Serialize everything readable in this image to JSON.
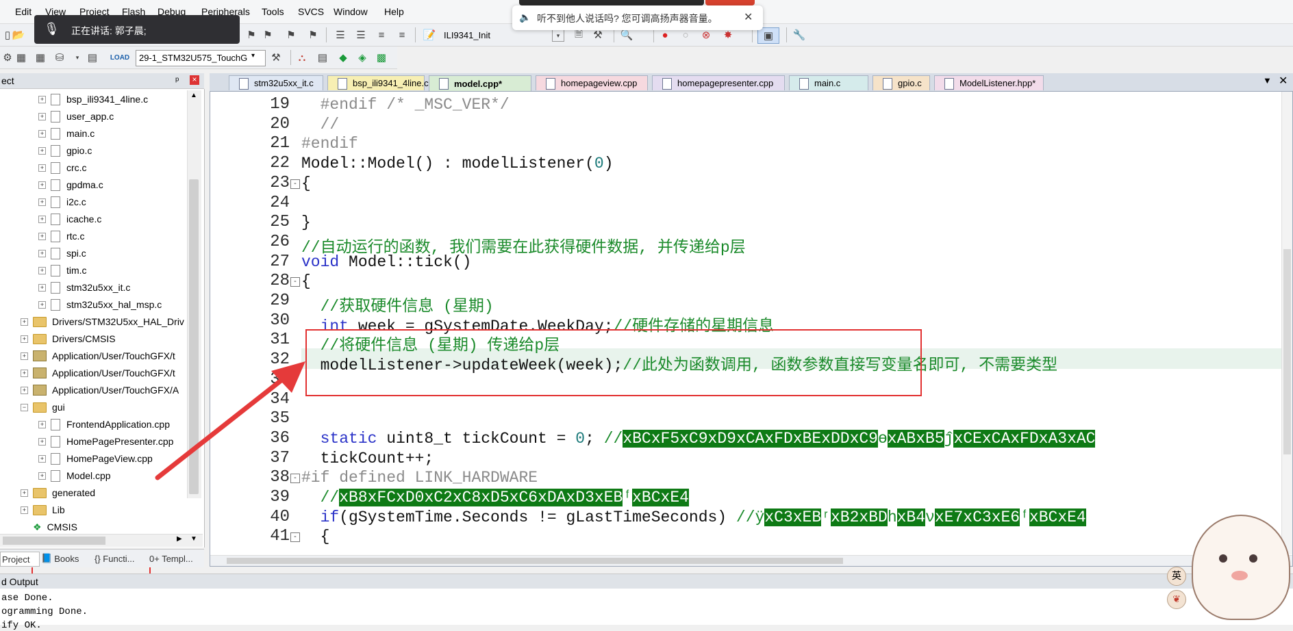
{
  "menu": [
    "Edit",
    "View",
    "Project",
    "Flash",
    "Debug",
    "Peripherals",
    "Tools",
    "SVCS",
    "Window",
    "Help"
  ],
  "toolbar": {
    "target_func": "ILI9341_Init",
    "target_name": "29-1_STM32U575_TouchG"
  },
  "mic_overlay": {
    "text": "正在讲话: 郭子晨;"
  },
  "notice": {
    "text": "听不到他人说话吗? 您可调高扬声器音量。",
    "close": "✕"
  },
  "project_panel": {
    "title": "ect",
    "pin": "ᵖ",
    "close": "×",
    "tree": [
      {
        "label": "bsp_ili9341_4line.c",
        "kind": "file",
        "indent": 1
      },
      {
        "label": "user_app.c",
        "kind": "file",
        "indent": 1
      },
      {
        "label": "main.c",
        "kind": "file",
        "indent": 1
      },
      {
        "label": "gpio.c",
        "kind": "file",
        "indent": 1
      },
      {
        "label": "crc.c",
        "kind": "file",
        "indent": 1
      },
      {
        "label": "gpdma.c",
        "kind": "file",
        "indent": 1
      },
      {
        "label": "i2c.c",
        "kind": "file",
        "indent": 1
      },
      {
        "label": "icache.c",
        "kind": "file",
        "indent": 1
      },
      {
        "label": "rtc.c",
        "kind": "file",
        "indent": 1
      },
      {
        "label": "spi.c",
        "kind": "file",
        "indent": 1
      },
      {
        "label": "tim.c",
        "kind": "file",
        "indent": 1
      },
      {
        "label": "stm32u5xx_it.c",
        "kind": "file",
        "indent": 1
      },
      {
        "label": "stm32u5xx_hal_msp.c",
        "kind": "file",
        "indent": 1
      },
      {
        "label": "Drivers/STM32U5xx_HAL_Driv",
        "kind": "folder",
        "indent": 0
      },
      {
        "label": "Drivers/CMSIS",
        "kind": "folder",
        "indent": 0
      },
      {
        "label": "Application/User/TouchGFX/t",
        "kind": "app",
        "indent": 0
      },
      {
        "label": "Application/User/TouchGFX/t",
        "kind": "app",
        "indent": 0
      },
      {
        "label": "Application/User/TouchGFX/A",
        "kind": "app",
        "indent": 0
      },
      {
        "label": "gui",
        "kind": "folder-open",
        "indent": 0
      },
      {
        "label": "FrontendApplication.cpp",
        "kind": "file",
        "indent": 1
      },
      {
        "label": "HomePagePresenter.cpp",
        "kind": "file",
        "indent": 1
      },
      {
        "label": "HomePageView.cpp",
        "kind": "file",
        "indent": 1
      },
      {
        "label": "Model.cpp",
        "kind": "file",
        "indent": 1
      },
      {
        "label": "generated",
        "kind": "folder",
        "indent": 0
      },
      {
        "label": "Lib",
        "kind": "folder",
        "indent": 0
      },
      {
        "label": "CMSIS",
        "kind": "gem",
        "indent": 0
      }
    ],
    "tabs": [
      "Project",
      "Books",
      "{} Functi...",
      "0+ Templ..."
    ]
  },
  "editor_tabs": [
    {
      "label": "stm32u5xx_it.c",
      "color": "#dfe7f3"
    },
    {
      "label": "bsp_ili9341_4line.c",
      "color": "#f7efb3"
    },
    {
      "label": "model.cpp*",
      "color": "#d8ecd4",
      "active": true
    },
    {
      "label": "homepageview.cpp",
      "color": "#f6d9df"
    },
    {
      "label": "homepagepresenter.cpp",
      "color": "#e4dcf0"
    },
    {
      "label": "main.c",
      "color": "#d5ebeb"
    },
    {
      "label": "gpio.c",
      "color": "#f6e3c9"
    },
    {
      "label": "ModelListener.hpp*",
      "color": "#f2dcea"
    }
  ],
  "code_lines": [
    {
      "n": "19",
      "parts": [
        [
          "pp",
          "  #endif /* _MSC_VER*/"
        ]
      ]
    },
    {
      "n": "20",
      "parts": [
        [
          "pp",
          "  //"
        ]
      ]
    },
    {
      "n": "21",
      "parts": [
        [
          "pp",
          "#endif"
        ]
      ]
    },
    {
      "n": "22",
      "parts": [
        [
          "id",
          "Model::Model() : modelListener("
        ],
        [
          "num",
          "0"
        ],
        [
          "id",
          ")"
        ]
      ]
    },
    {
      "n": "23",
      "parts": [
        [
          "id",
          "{"
        ]
      ],
      "fold": "-"
    },
    {
      "n": "24",
      "parts": [
        [
          "id",
          ""
        ]
      ]
    },
    {
      "n": "25",
      "parts": [
        [
          "id",
          "}"
        ]
      ]
    },
    {
      "n": "26",
      "parts": [
        [
          "cm",
          "//自动运行的函数, 我们需要在此获得硬件数据, 并传递给p层"
        ]
      ]
    },
    {
      "n": "27",
      "parts": [
        [
          "kw",
          "void"
        ],
        [
          "id",
          " Model::tick()"
        ]
      ]
    },
    {
      "n": "28",
      "parts": [
        [
          "id",
          "{"
        ]
      ],
      "fold": "-"
    },
    {
      "n": "29",
      "parts": [
        [
          "cm",
          "  //获取硬件信息 (星期)"
        ]
      ]
    },
    {
      "n": "30",
      "parts": [
        [
          "kw",
          "  int"
        ],
        [
          "id",
          " week = gSystemDate.WeekDay;"
        ],
        [
          "cm",
          "//硬件存储的星期信息"
        ]
      ]
    },
    {
      "n": "31",
      "parts": [
        [
          "cm",
          "  //将硬件信息 (星期) 传递给p层"
        ]
      ]
    },
    {
      "n": "32",
      "parts": [
        [
          "id",
          "  modelListener->updateWeek(week);"
        ],
        [
          "cm",
          "//此处为函数调用, 函数参数直接写变量名即可, 不需要类型"
        ]
      ]
    },
    {
      "n": "33",
      "parts": [
        [
          "id",
          ""
        ]
      ]
    },
    {
      "n": "34",
      "parts": [
        [
          "id",
          ""
        ]
      ]
    },
    {
      "n": "35",
      "parts": [
        [
          "id",
          ""
        ]
      ]
    },
    {
      "n": "36",
      "parts": [
        [
          "kw",
          "  static"
        ],
        [
          "id",
          " uint8_t tickCount = "
        ],
        [
          "num",
          "0"
        ],
        [
          "id",
          "; "
        ],
        [
          "cm",
          "//"
        ],
        [
          "hl",
          "xBCxF5xC9xD9xCAxFDxBExDDxC9"
        ],
        [
          "cm",
          "ɵ"
        ],
        [
          "hl",
          "xABxB5"
        ],
        [
          "cm",
          "ĵ"
        ],
        [
          "hl",
          "xCExCAxFDxA3xAC"
        ]
      ]
    },
    {
      "n": "37",
      "parts": [
        [
          "id",
          "  tickCount++;"
        ]
      ]
    },
    {
      "n": "38",
      "parts": [
        [
          "pp",
          "#if defined LINK_HARDWARE"
        ]
      ],
      "fold": "-"
    },
    {
      "n": "39",
      "parts": [
        [
          "cm",
          "  //"
        ],
        [
          "hl",
          "xB8xFCxD0xC2xC8xD5xC6xDAxD3xEB"
        ],
        [
          "cm",
          "ᶠ"
        ],
        [
          "hl",
          "xBCxE4"
        ]
      ]
    },
    {
      "n": "40",
      "parts": [
        [
          "kw",
          "  if"
        ],
        [
          "id",
          "(gSystemTime.Seconds != gLastTimeSeconds) "
        ],
        [
          "cm",
          "//ÿ"
        ],
        [
          "hl",
          "xC3xEB"
        ],
        [
          "cm",
          "ʳ"
        ],
        [
          "hl",
          "xB2xBD"
        ],
        [
          "cm",
          "h"
        ],
        [
          "hl",
          "xB4"
        ],
        [
          "cm",
          "ν"
        ],
        [
          "hl",
          "xE7xC3xE6"
        ],
        [
          "cm",
          "ᶠ"
        ],
        [
          "hl",
          "xBCxE4"
        ]
      ]
    },
    {
      "n": "41",
      "parts": [
        [
          "id",
          "  {"
        ]
      ],
      "fold": "-"
    }
  ],
  "output": {
    "title": "d Output",
    "lines": [
      "ase Done.",
      "ogramming Done.",
      "ify OK."
    ]
  },
  "corner_badges": [
    "英",
    ""
  ]
}
